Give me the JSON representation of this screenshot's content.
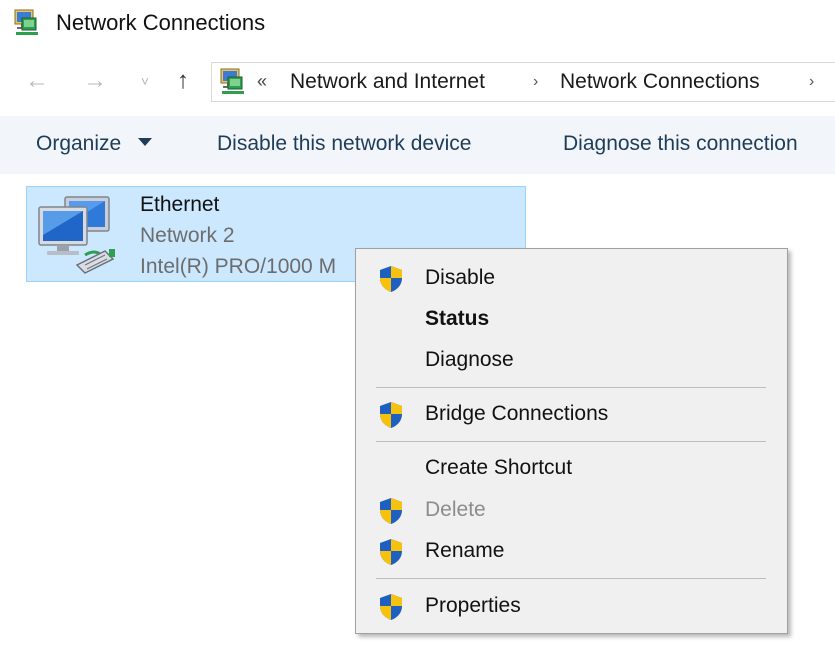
{
  "window": {
    "title": "Network Connections"
  },
  "nav": {
    "back_glyph": "←",
    "forward_glyph": "→",
    "recent_glyph": "˅",
    "up_glyph": "↑",
    "address_overflow": "«",
    "breadcrumbs": [
      {
        "label": "Network and Internet"
      },
      {
        "label": "Network Connections"
      }
    ],
    "separator_glyph": "›"
  },
  "commandbar": {
    "organize_label": "Organize",
    "disable_label": "Disable this network device",
    "diagnose_label": "Diagnose this connection"
  },
  "item": {
    "name": "Ethernet",
    "network": "Network 2",
    "adapter": "Intel(R) PRO/1000 M"
  },
  "context_menu": {
    "items": [
      {
        "label": "Disable",
        "icon": "shield-icon",
        "bold": false,
        "enabled": true
      },
      {
        "label": "Status",
        "icon": null,
        "bold": true,
        "enabled": true
      },
      {
        "label": "Diagnose",
        "icon": null,
        "bold": false,
        "enabled": true
      },
      {
        "label": "Bridge Connections",
        "icon": "shield-icon",
        "bold": false,
        "enabled": true
      },
      {
        "label": "Create Shortcut",
        "icon": null,
        "bold": false,
        "enabled": true
      },
      {
        "label": "Delete",
        "icon": "shield-icon",
        "bold": false,
        "enabled": false
      },
      {
        "label": "Rename",
        "icon": "shield-icon",
        "bold": false,
        "enabled": true
      },
      {
        "label": "Properties",
        "icon": "shield-icon",
        "bold": false,
        "enabled": true
      }
    ]
  },
  "colors": {
    "selection_bg": "#cce8ff",
    "selection_border": "#99d1ff",
    "commandbar_bg": "#f2f5f9",
    "command_text": "#1e3d59",
    "menu_bg": "#f0f0f0",
    "shield_blue": "#1f5fbf",
    "shield_yellow": "#f6c20e"
  }
}
